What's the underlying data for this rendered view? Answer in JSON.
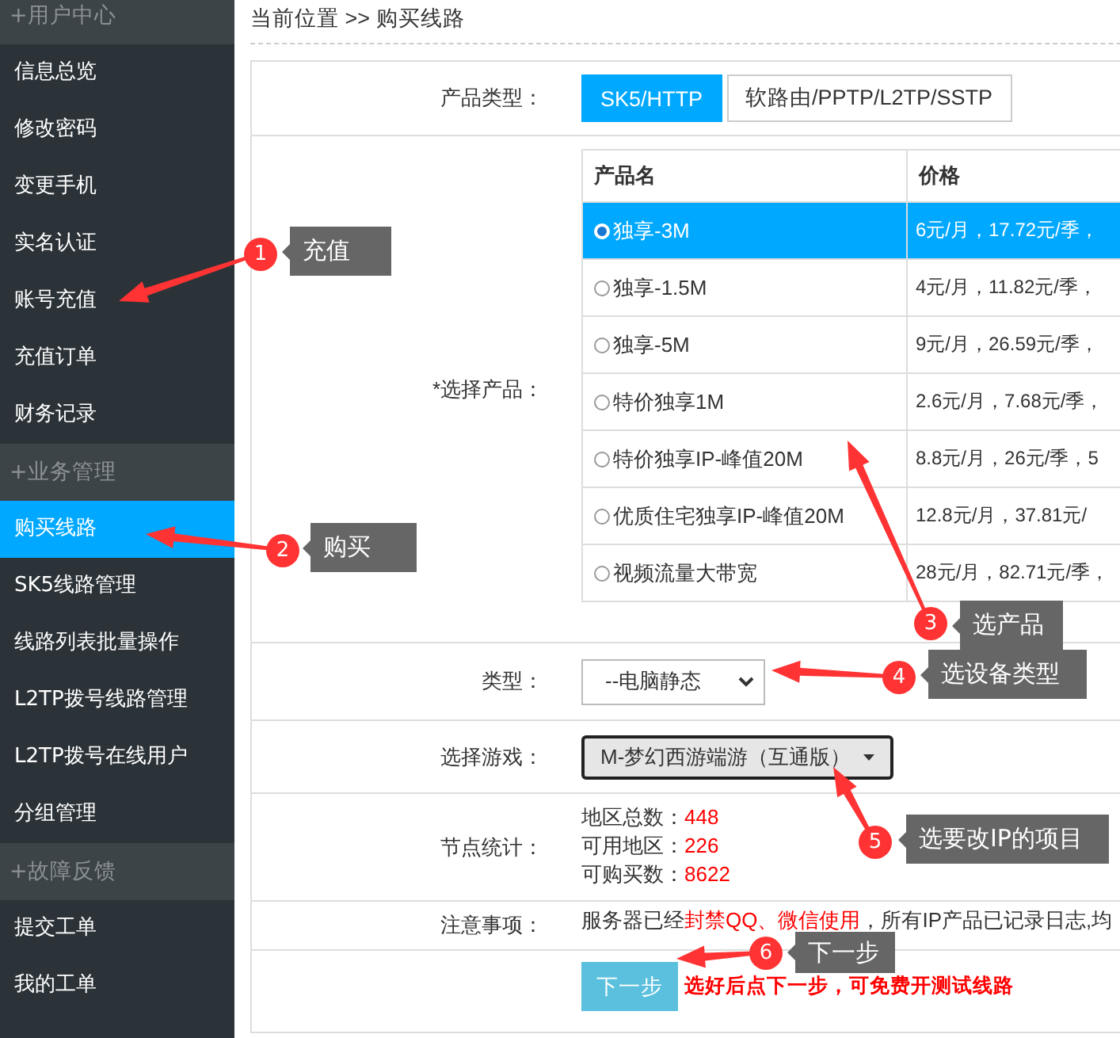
{
  "sidebar": {
    "groups": [
      {
        "title": "+用户中心",
        "items": [
          {
            "label": "信息总览",
            "selected": false
          },
          {
            "label": "修改密码",
            "selected": false
          },
          {
            "label": "变更手机",
            "selected": false
          },
          {
            "label": "实名认证",
            "selected": false
          },
          {
            "label": "账号充值",
            "selected": false
          },
          {
            "label": "充值订单",
            "selected": false
          },
          {
            "label": "财务记录",
            "selected": false
          }
        ]
      },
      {
        "title": "+业务管理",
        "items": [
          {
            "label": "购买线路",
            "selected": true
          },
          {
            "label": "SK5线路管理",
            "selected": false
          },
          {
            "label": "线路列表批量操作",
            "selected": false
          },
          {
            "label": "L2TP拨号线路管理",
            "selected": false
          },
          {
            "label": "L2TP拨号在线用户",
            "selected": false
          },
          {
            "label": "分组管理",
            "selected": false
          }
        ]
      },
      {
        "title": "+故障反馈",
        "items": [
          {
            "label": "提交工单",
            "selected": false
          },
          {
            "label": "我的工单",
            "selected": false
          }
        ]
      }
    ]
  },
  "breadcrumb": "当前位置 >> 购买线路",
  "form": {
    "product_type": {
      "label": "产品类型：",
      "options": [
        {
          "label": "SK5/HTTP",
          "selected": true
        },
        {
          "label": "软路由/PPTP/L2TP/SSTP",
          "selected": false
        }
      ]
    },
    "products": {
      "label": "*选择产品：",
      "columns": [
        "产品名",
        "价格"
      ],
      "rows": [
        {
          "name": "独享-3M",
          "price": "6元/月，17.72元/季，",
          "selected": true
        },
        {
          "name": "独享-1.5M",
          "price": "4元/月，11.82元/季，",
          "selected": false
        },
        {
          "name": "独享-5M",
          "price": "9元/月，26.59元/季，",
          "selected": false
        },
        {
          "name": "特价独享1M",
          "price": "2.6元/月，7.68元/季，",
          "selected": false
        },
        {
          "name": "特价独享IP-峰值20M",
          "price": "8.8元/月，26元/季，5",
          "selected": false
        },
        {
          "name": "优质住宅独享IP-峰值20M",
          "price": "12.8元/月，37.81元/",
          "selected": false
        },
        {
          "name": "视频流量大带宽",
          "price": "28元/月，82.71元/季，",
          "selected": false
        }
      ]
    },
    "device_type": {
      "label": "类型：",
      "value": "--电脑静态"
    },
    "game": {
      "label": "选择游戏：",
      "value": "M-梦幻西游端游（互通版）"
    },
    "stats": {
      "label": "节点统计：",
      "lines": [
        {
          "name": "地区总数：",
          "value": "448"
        },
        {
          "name": "可用地区：",
          "value": "226"
        },
        {
          "name": "可购买数：",
          "value": "8622"
        }
      ]
    },
    "notes": {
      "label": "注意事项：",
      "segments": [
        {
          "text": "服务器已经",
          "highlight": false
        },
        {
          "text": "封禁QQ、微信使用",
          "highlight": true
        },
        {
          "text": "，所有IP产品已记录日志,均",
          "highlight": false
        }
      ]
    },
    "next_button": "下一步",
    "hint": "选好后点下一步，可免费开测试线路"
  },
  "annotations": [
    {
      "number": "1",
      "label": "充值"
    },
    {
      "number": "2",
      "label": "购买"
    },
    {
      "number": "3",
      "label": "选产品"
    },
    {
      "number": "4",
      "label": "选设备类型"
    },
    {
      "number": "5",
      "label": "选要改IP的项目"
    },
    {
      "number": "6",
      "label": "下一步"
    }
  ]
}
